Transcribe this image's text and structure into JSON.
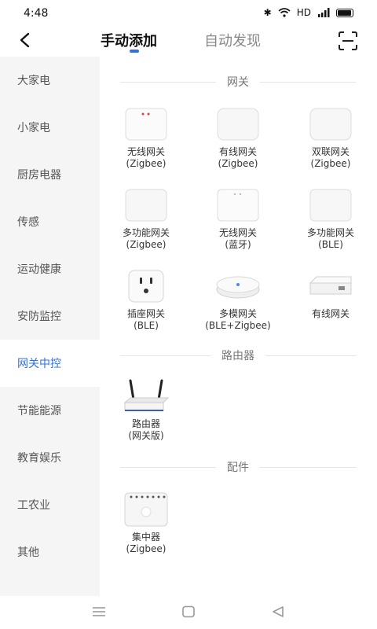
{
  "status": {
    "time": "4:48",
    "network": "HD"
  },
  "tabs": {
    "manual": "手动添加",
    "auto": "自动发现"
  },
  "sidebar": {
    "items": [
      {
        "label": "大家电"
      },
      {
        "label": "小家电"
      },
      {
        "label": "厨房电器"
      },
      {
        "label": "传感"
      },
      {
        "label": "运动健康"
      },
      {
        "label": "安防监控"
      },
      {
        "label": "网关中控"
      },
      {
        "label": "节能能源"
      },
      {
        "label": "教育娱乐"
      },
      {
        "label": "工农业"
      },
      {
        "label": "其他"
      }
    ],
    "selected": "网关中控"
  },
  "sections": [
    {
      "title": "网关",
      "devices": [
        {
          "label": "无线网关\n(Zigbee)"
        },
        {
          "label": "有线网关\n(Zigbee)"
        },
        {
          "label": "双联网关\n(Zigbee)"
        },
        {
          "label": "多功能网关\n(Zigbee)"
        },
        {
          "label": "无线网关\n(蓝牙)"
        },
        {
          "label": "多功能网关\n(BLE)"
        },
        {
          "label": "插座网关\n(BLE)"
        },
        {
          "label": "多模网关\n(BLE+Zigbee)"
        },
        {
          "label": "有线网关"
        }
      ]
    },
    {
      "title": "路由器",
      "devices": [
        {
          "label": "路由器\n(网关版)"
        }
      ]
    },
    {
      "title": "配件",
      "devices": [
        {
          "label": "集中器\n(Zigbee)"
        }
      ]
    }
  ],
  "colors": {
    "accent": "#2f6fe8",
    "sidebar_bg": "#f5f5f5"
  }
}
